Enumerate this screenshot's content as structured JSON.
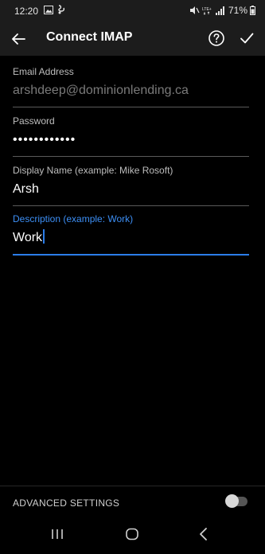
{
  "status_bar": {
    "time": "12:20",
    "battery": "71%"
  },
  "app_bar": {
    "title": "Connect IMAP"
  },
  "fields": {
    "email": {
      "label": "Email Address",
      "value": "arshdeep@dominionlending.ca"
    },
    "password": {
      "label": "Password",
      "value": "••••••••••••"
    },
    "display_name": {
      "label": "Display Name (example: Mike Rosoft)",
      "value": "Arsh"
    },
    "description": {
      "label": "Description (example: Work)",
      "value": "Work"
    }
  },
  "advanced": {
    "label": "ADVANCED SETTINGS",
    "enabled": false
  },
  "colors": {
    "accent": "#2b7de9",
    "background": "#000000",
    "bar": "#1c1c1c"
  }
}
